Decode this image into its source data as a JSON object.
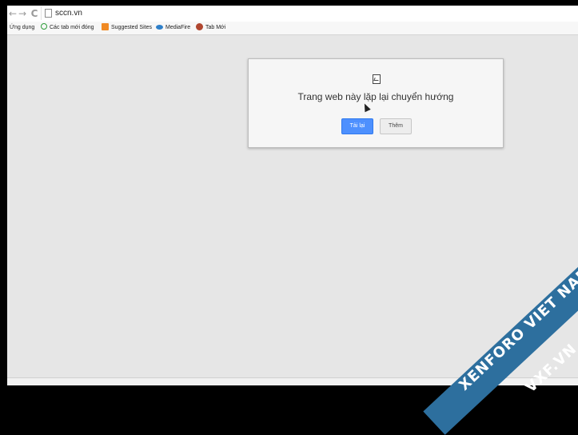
{
  "toolbar": {
    "back_icon": "←",
    "forward_icon": "→",
    "reload_icon": "C",
    "url": "sccn.vn"
  },
  "bookmarks": [
    {
      "label": "Ứng dụng",
      "icon": "apps-icon"
    },
    {
      "label": "Các tab mới đóng",
      "icon": "recent-tabs-icon"
    },
    {
      "label": "Suggested Sites",
      "icon": "suggested-sites-icon"
    },
    {
      "label": "MediaFire",
      "icon": "mediafire-icon"
    },
    {
      "label": "Tab Mới",
      "icon": "new-tab-icon"
    }
  ],
  "error": {
    "title": "Trang web này lặp lại chuyển hướng",
    "reload_label": "Tải lại",
    "more_label": "Thêm"
  },
  "watermark": {
    "line1": "XENFORO VIET NAM",
    "line2": "VXF.VN"
  },
  "colors": {
    "accent": "#4d90fe",
    "background": "#e6e6e6",
    "watermark": "#2d6f9e"
  }
}
